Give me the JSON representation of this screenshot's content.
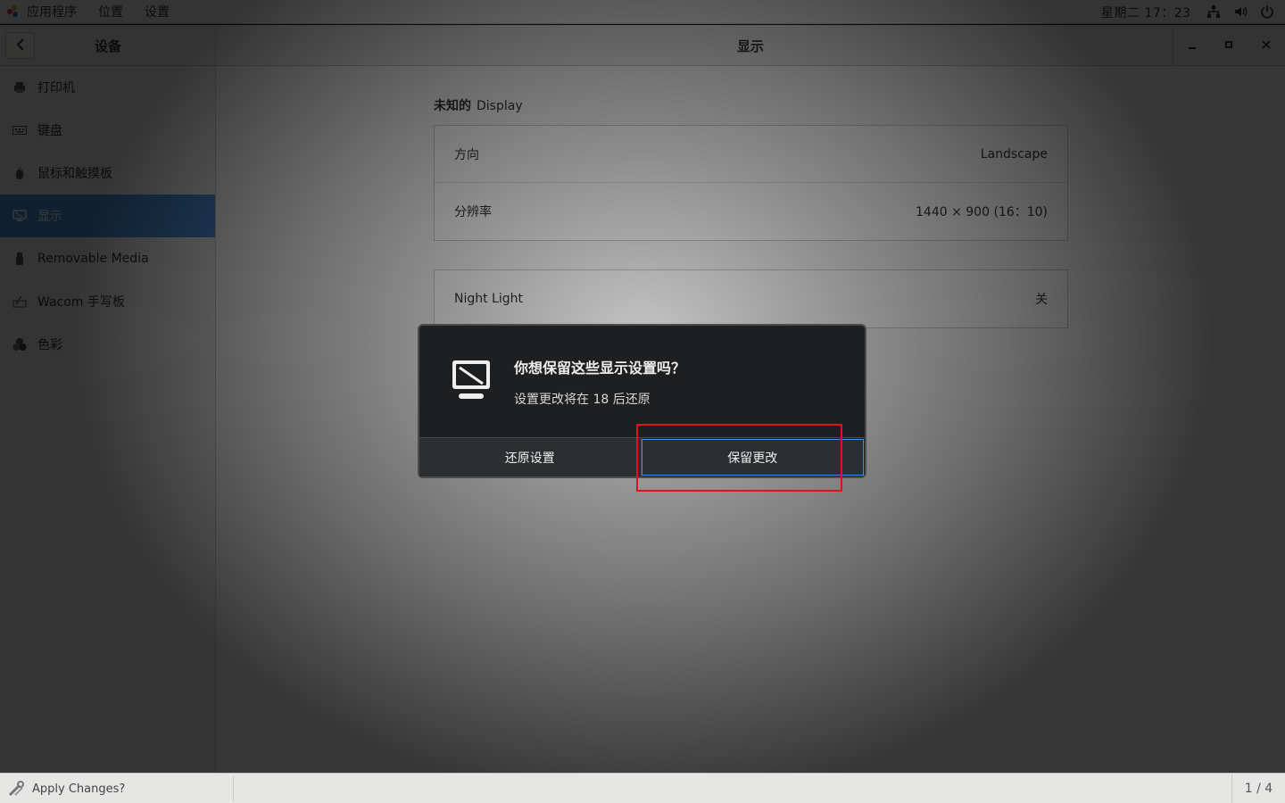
{
  "topbar": {
    "menu": [
      "应用程序",
      "位置",
      "设置"
    ],
    "clock": "星期二 17：23",
    "tray_icons": [
      "network-icon",
      "volume-icon",
      "power-icon"
    ]
  },
  "window": {
    "sidebar_title": "设备",
    "main_title": "显示",
    "window_buttons": [
      "minimize-icon",
      "maximize-icon",
      "close-icon"
    ]
  },
  "sidebar": {
    "items": [
      {
        "label": "打印机",
        "icon": "printer-icon"
      },
      {
        "label": "键盘",
        "icon": "keyboard-icon"
      },
      {
        "label": "鼠标和触摸板",
        "icon": "mouse-icon"
      },
      {
        "label": "显示",
        "icon": "display-icon",
        "active": true
      },
      {
        "label": "Removable Media",
        "icon": "usb-icon"
      },
      {
        "label": "Wacom 手写板",
        "icon": "tablet-icon"
      },
      {
        "label": "色彩",
        "icon": "color-icon"
      }
    ]
  },
  "display": {
    "group_label": "未知的",
    "group_label_en": "Display",
    "orientation_label": "方向",
    "orientation_value": "Landscape",
    "resolution_label": "分辨率",
    "resolution_value": "1440 × 900 (16：10)",
    "night_light_label": "Night Light",
    "night_light_value": "关"
  },
  "dialog": {
    "title": "你想保留这些显示设置吗？",
    "subtitle": "设置更改将在 18 后还原",
    "revert_label": "还原设置",
    "keep_label": "保留更改"
  },
  "taskbar": {
    "task_label": "Apply Changes?",
    "workspace": "1 / 4"
  },
  "colors": {
    "accent": "#4a90d9",
    "annotation": "#e0121b",
    "dialog_bg": "#1d1f20"
  }
}
